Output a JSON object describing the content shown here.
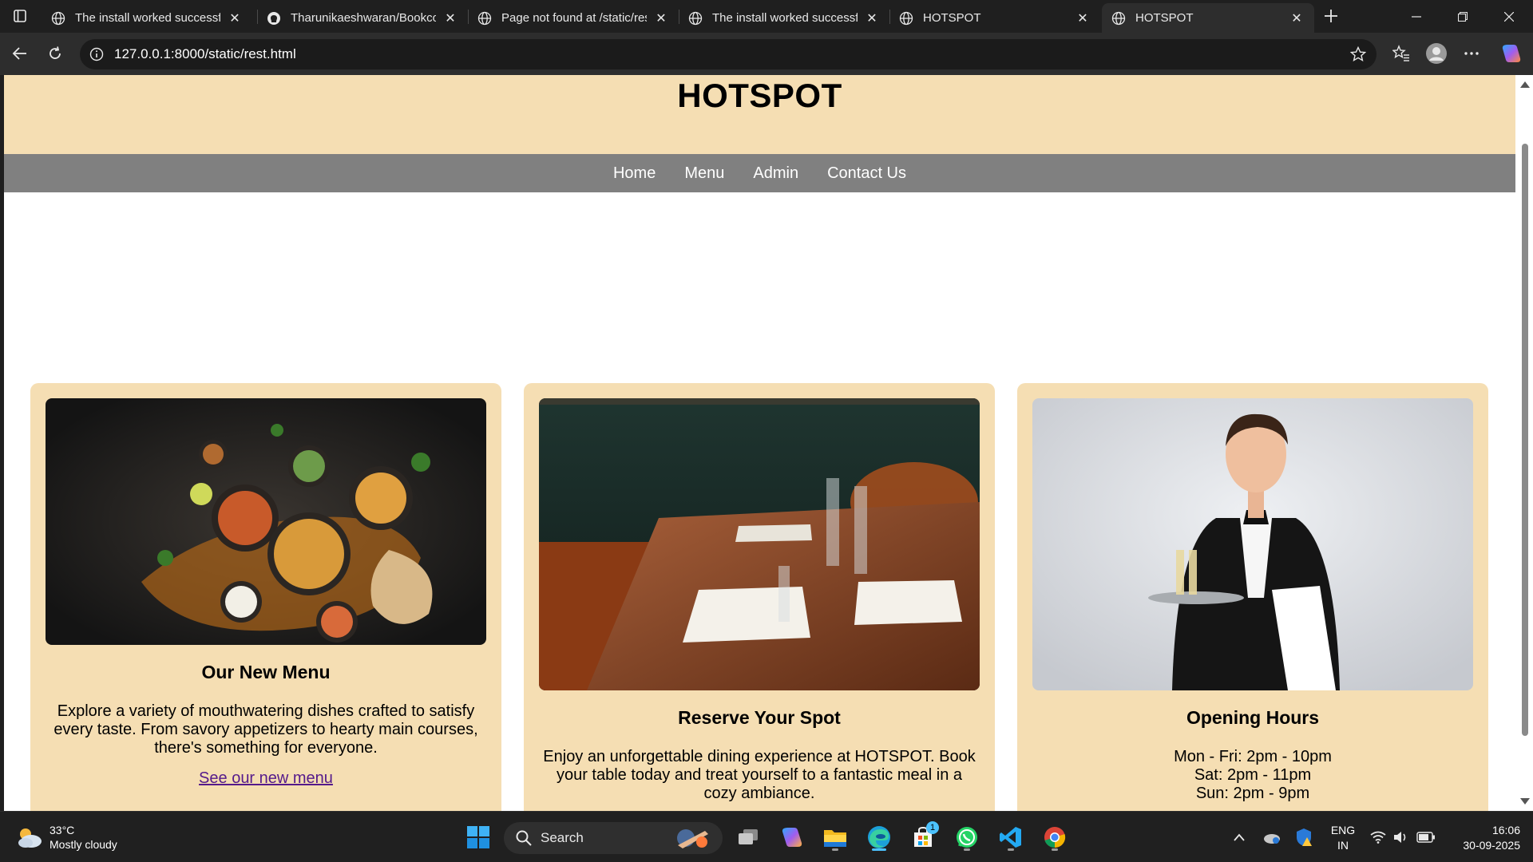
{
  "browser": {
    "tabs": [
      {
        "title": "The install worked successfu",
        "icon": "globe-icon",
        "active": false
      },
      {
        "title": "Tharunikaeshwaran/Bookcov",
        "icon": "github-icon",
        "active": false
      },
      {
        "title": "Page not found at /static/res",
        "icon": "globe-icon",
        "active": false
      },
      {
        "title": "The install worked successfu",
        "icon": "globe-icon",
        "active": false
      },
      {
        "title": "HOTSPOT",
        "icon": "globe-icon",
        "active": false
      },
      {
        "title": "HOTSPOT",
        "icon": "globe-icon",
        "active": true
      }
    ],
    "url": "127.0.0.1:8000/static/rest.html"
  },
  "site": {
    "title": "HOTSPOT",
    "nav": [
      "Home",
      "Menu",
      "Admin",
      "Contact Us"
    ],
    "cards": [
      {
        "heading": "Our New Menu",
        "text": "Explore a variety of mouthwatering dishes crafted to satisfy every taste. From savory appetizers to hearty main courses, there's something for everyone.",
        "link": "See our new menu"
      },
      {
        "heading": "Reserve Your Spot",
        "text": "Enjoy an unforgettable dining experience at HOTSPOT. Book your table today and treat yourself to a fantastic meal in a cozy ambiance."
      },
      {
        "heading": "Opening Hours",
        "hours": [
          "Mon - Fri: 2pm - 10pm",
          "Sat: 2pm - 11pm",
          "Sun: 2pm - 9pm"
        ]
      }
    ],
    "colors": {
      "header_bg": "#f5deb3",
      "nav_bg": "#808080",
      "card_bg": "#f5deb3",
      "link": "#551a8b"
    }
  },
  "taskbar": {
    "weather_temp": "33°C",
    "weather_desc": "Mostly cloudy",
    "search_label": "Search",
    "store_badge": "1",
    "lang_top": "ENG",
    "lang_bottom": "IN",
    "time": "16:06",
    "date": "30-09-2025"
  }
}
